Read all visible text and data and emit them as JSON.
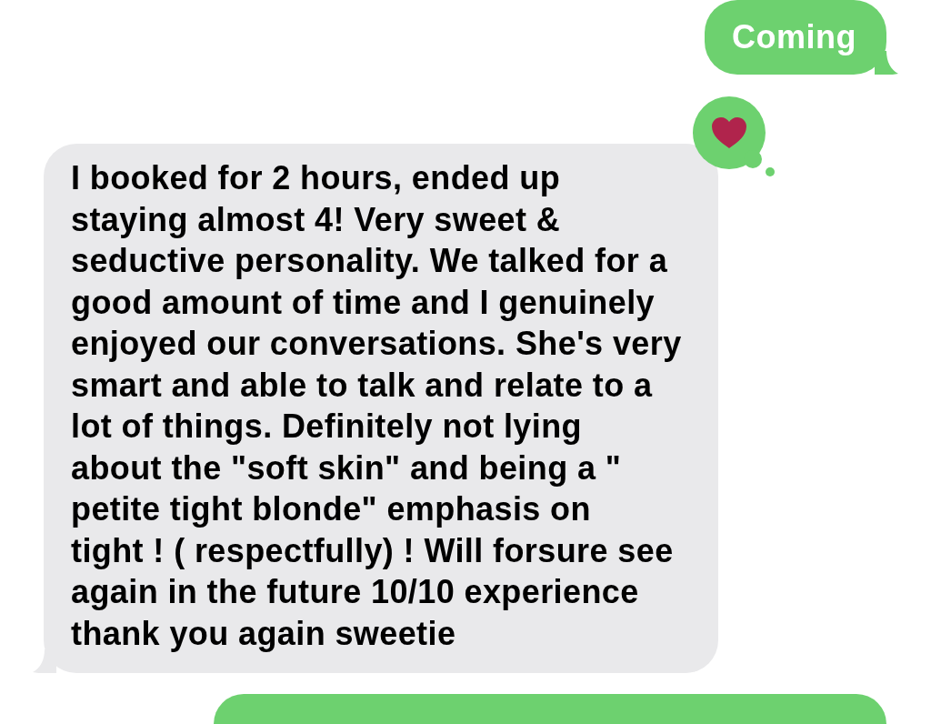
{
  "messages": [
    {
      "kind": "sent",
      "text": "Coming",
      "loved": false
    },
    {
      "kind": "received",
      "text": "I booked for 2 hours, ended up\nstaying almost 4! Very sweet &\nseductive personality. We talked for a\ngood amount of time and I genuinely\nenjoyed our conversations. She's very\nsmart and able to talk and relate to a\nlot of things. Definitely not lying\nabout the \"soft skin\" and being a \"\npetite tight blonde\" emphasis on\ntight ! ( respectfully) ! Will forsure see\nagain in the future 10/10 experience\nthank you again sweetie",
      "loved": true
    },
    {
      "kind": "sent",
      "loved": false
    }
  ]
}
